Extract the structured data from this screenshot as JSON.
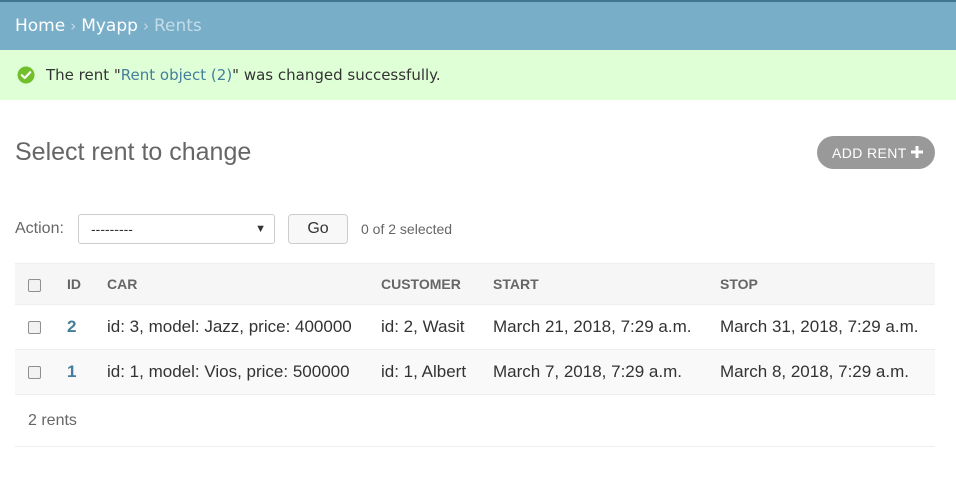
{
  "breadcrumbs": {
    "home": "Home",
    "app": "Myapp",
    "current": "Rents",
    "separator": "›"
  },
  "message": {
    "prefix": "The rent \"",
    "link_text": "Rent object (2)",
    "suffix": "\" was changed successfully.",
    "icon": "success-check-icon",
    "color": "#70bf2b"
  },
  "page": {
    "title": "Select rent to change",
    "add_button_label": "ADD RENT",
    "add_icon": "plus-icon"
  },
  "actions": {
    "label": "Action:",
    "selected_option": "---------",
    "go_label": "Go",
    "selection_count": "0 of 2 selected"
  },
  "table": {
    "columns": [
      "ID",
      "CAR",
      "CUSTOMER",
      "START",
      "STOP"
    ],
    "rows": [
      {
        "id": "2",
        "car": "id: 3, model: Jazz, price: 400000",
        "customer": "id: 2, Wasit",
        "start": "March 21, 2018, 7:29 a.m.",
        "stop": "March 31, 2018, 7:29 a.m."
      },
      {
        "id": "1",
        "car": "id: 1, model: Vios, price: 500000",
        "customer": "id: 1, Albert",
        "start": "March 7, 2018, 7:29 a.m.",
        "stop": "March 8, 2018, 7:29 a.m."
      }
    ]
  },
  "paginator": {
    "text": "2 rents"
  },
  "colors": {
    "header_bg": "#79aec8",
    "message_bg": "#dfffd6",
    "link": "#447e9b",
    "add_button_bg": "#999999"
  }
}
